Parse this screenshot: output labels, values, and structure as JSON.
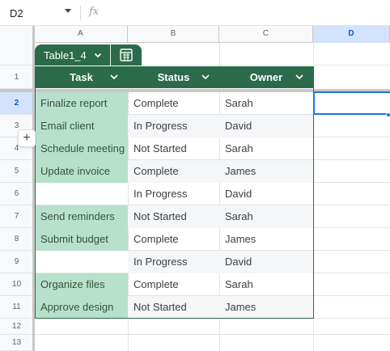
{
  "name_box": "D2",
  "fx_label": "fx",
  "columns": [
    "A",
    "B",
    "C",
    "D"
  ],
  "rows": [
    "1",
    "2",
    "3",
    "4",
    "5",
    "6",
    "7",
    "8",
    "9",
    "10",
    "11",
    "12",
    "13"
  ],
  "table": {
    "name": "Table1_4",
    "headers": [
      "Task",
      "Status",
      "Owner"
    ],
    "data": [
      {
        "task": "Finalize report",
        "status": "Complete",
        "owner": "Sarah"
      },
      {
        "task": "Email client",
        "status": "In Progress",
        "owner": "David"
      },
      {
        "task": "Schedule meeting",
        "status": "Not Started",
        "owner": "Sarah"
      },
      {
        "task": "Update invoice",
        "status": "Complete",
        "owner": "James"
      },
      {
        "task": "",
        "status": "In Progress",
        "owner": "David"
      },
      {
        "task": "Send reminders",
        "status": "Not Started",
        "owner": "Sarah"
      },
      {
        "task": "Submit budget",
        "status": "Complete",
        "owner": "James"
      },
      {
        "task": "",
        "status": "In Progress",
        "owner": "David"
      },
      {
        "task": "Organize files",
        "status": "Complete",
        "owner": "Sarah"
      },
      {
        "task": "Approve design",
        "status": "Not Started",
        "owner": "James"
      }
    ]
  },
  "add_row_symbol": "+",
  "colors": {
    "table_header": "#2b6b4b",
    "task_fill": "#b7e1cd",
    "selection": "#1a73e8"
  }
}
